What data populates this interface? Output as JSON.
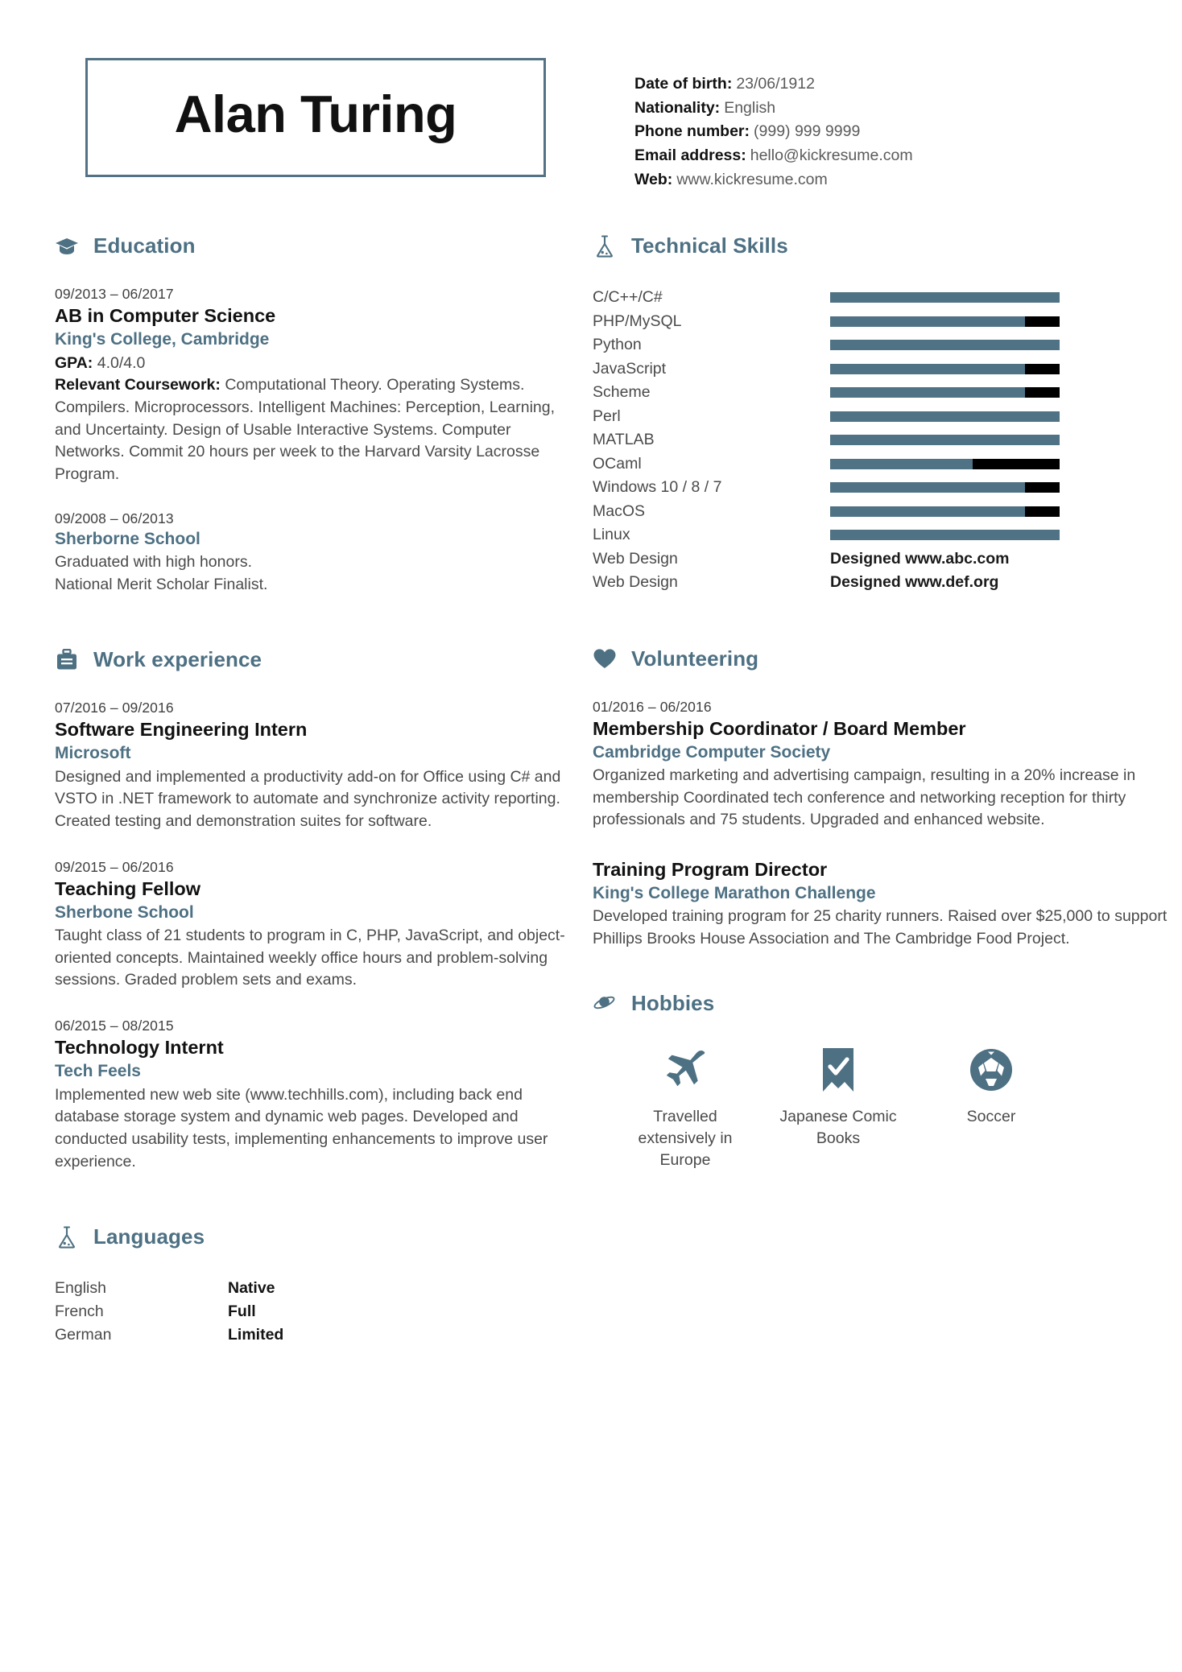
{
  "theme": {
    "accent": "#4d7083",
    "bar_fill": "#4f7285",
    "bar_track": "#000000",
    "text": "#4a4a4a",
    "heading": "#111111"
  },
  "header": {
    "name": "Alan Turing",
    "contact": [
      {
        "label": "Date of birth:",
        "value": "23/06/1912"
      },
      {
        "label": "Nationality:",
        "value": "English"
      },
      {
        "label": "Phone number:",
        "value": "(999) 999 9999"
      },
      {
        "label": "Email address:",
        "value": "hello@kickresume.com"
      },
      {
        "label": "Web:",
        "value": "www.kickresume.com"
      }
    ]
  },
  "education": {
    "title": "Education",
    "icon": "graduation-cap-icon",
    "entries": [
      {
        "date": "09/2013 – 06/2017",
        "title": "AB in Computer Science",
        "org": "King's College, Cambridge",
        "gpa_label": "GPA:",
        "gpa_value": "4.0/4.0",
        "coursework_label": "Relevant Coursework:",
        "coursework_value": "Computational Theory. Operating Systems. Compilers. Microprocessors. Intelligent Machines: Perception, Learning, and Uncertainty. Design of Usable Interactive Systems. Computer Networks. Commit 20 hours per week to the Harvard Varsity Lacrosse Program."
      },
      {
        "date": "09/2008 – 06/2013",
        "title": "",
        "org": "Sherborne School",
        "desc": "Graduated with high honors.\nNational Merit Scholar Finalist."
      }
    ]
  },
  "work": {
    "title": "Work experience",
    "icon": "briefcase-icon",
    "entries": [
      {
        "date": "07/2016 – 09/2016",
        "title": "Software Engineering Intern",
        "org": "Microsoft",
        "desc": "Designed and implemented a productivity add-on for Office using C# and VSTO in .NET framework to automate and synchronize activity reporting. Created testing and demonstration suites for software."
      },
      {
        "date": "09/2015 – 06/2016",
        "title": "Teaching Fellow",
        "org": "Sherbone School",
        "desc": "Taught class of 21 students to program in C, PHP, JavaScript, and object-oriented concepts. Maintained weekly office hours and problem-solving sessions. Graded problem sets and exams."
      },
      {
        "date": "06/2015 – 08/2015",
        "title": "Technology Internt",
        "org": "Tech Feels",
        "desc": "Implemented new web site (www.techhills.com), including back end database storage system and dynamic web pages. Developed and conducted usability tests, implementing enhancements to improve user experience."
      }
    ]
  },
  "languages": {
    "title": "Languages",
    "icon": "flask-icon",
    "rows": [
      {
        "name": "English",
        "level": "Native"
      },
      {
        "name": "French",
        "level": "Full"
      },
      {
        "name": "German",
        "level": "Limited"
      }
    ]
  },
  "skills": {
    "title": "Technical Skills",
    "icon": "flask-icon",
    "rows": [
      {
        "name": "C/C++/C#",
        "type": "bar",
        "percent": 100
      },
      {
        "name": "PHP/MySQL",
        "type": "bar",
        "percent": 85
      },
      {
        "name": "Python",
        "type": "bar",
        "percent": 100
      },
      {
        "name": "JavaScript",
        "type": "bar",
        "percent": 85
      },
      {
        "name": "Scheme",
        "type": "bar",
        "percent": 85
      },
      {
        "name": "Perl",
        "type": "bar",
        "percent": 100
      },
      {
        "name": "MATLAB",
        "type": "bar",
        "percent": 100
      },
      {
        "name": "OCaml",
        "type": "bar",
        "percent": 62
      },
      {
        "name": "Windows 10 / 8 / 7",
        "type": "bar",
        "percent": 85
      },
      {
        "name": "MacOS",
        "type": "bar",
        "percent": 85
      },
      {
        "name": "Linux",
        "type": "bar",
        "percent": 100
      },
      {
        "name": "Web Design",
        "type": "text",
        "value": "Designed www.abc.com"
      },
      {
        "name": "Web Design",
        "type": "text",
        "value": "Designed www.def.org"
      }
    ]
  },
  "volunteering": {
    "title": "Volunteering",
    "icon": "heart-icon",
    "entries": [
      {
        "date": "01/2016 – 06/2016",
        "title": "Membership Coordinator / Board Member",
        "org": "Cambridge Computer Society",
        "desc": "Organized marketing and advertising campaign, resulting in a 20% increase in membership Coordinated tech conference and networking reception for thirty professionals and 75 students. Upgraded and enhanced website."
      },
      {
        "date": "",
        "title": "Training Program Director",
        "org": "King's College Marathon Challenge",
        "desc": "Developed training program for 25 charity runners. Raised over $25,000 to support Phillips Brooks House Association and The Cambridge Food Project."
      }
    ]
  },
  "hobbies": {
    "title": "Hobbies",
    "icon": "planet-icon",
    "items": [
      {
        "icon": "airplane-icon",
        "label": "Travelled extensively in Europe"
      },
      {
        "icon": "bookmark-check-icon",
        "label": "Japanese Comic Books"
      },
      {
        "icon": "soccer-ball-icon",
        "label": "Soccer"
      }
    ]
  }
}
